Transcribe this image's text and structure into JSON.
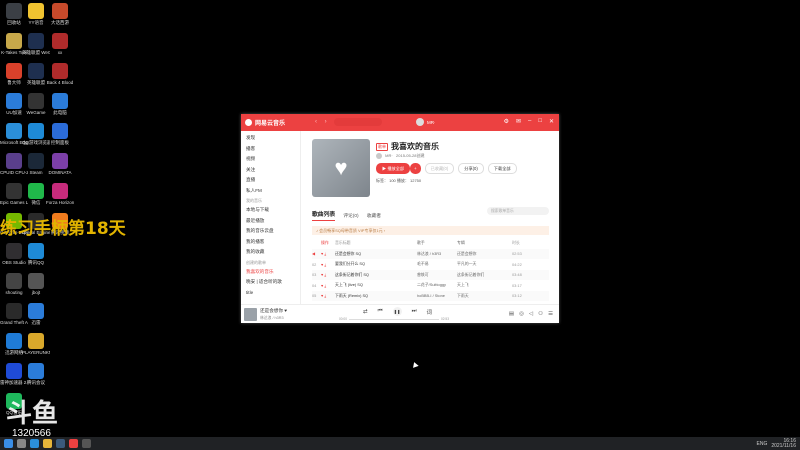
{
  "desktop": {
    "icons_col1": [
      {
        "label": "回收站",
        "icon": "recycle-bin",
        "color": "#3b3f45"
      },
      {
        "label": "K-Takes Tool",
        "icon": "ktakes",
        "color": "#c7a84a"
      },
      {
        "label": "鲁大师",
        "icon": "ludashi",
        "color": "#d9412b"
      },
      {
        "label": "UU加速",
        "icon": "uu-accelerator",
        "color": "#2b7cd9"
      },
      {
        "label": "Microsoft Edge",
        "icon": "edge",
        "color": "#2b8fd9"
      },
      {
        "label": "CPUID CPU-Z",
        "icon": "cpuz",
        "color": "#5a3f8c"
      },
      {
        "label": "Epic Games Launcher",
        "icon": "epic",
        "color": "#333333"
      },
      {
        "label": "GeForce Experience",
        "icon": "geforce",
        "color": "#76b900"
      },
      {
        "label": "OBS Studio",
        "icon": "obs",
        "color": "#302e31"
      },
      {
        "label": "shouting",
        "icon": "shouting",
        "color": "#444444"
      },
      {
        "label": "Grand Theft Auto V",
        "icon": "gta",
        "color": "#2a2a2a"
      },
      {
        "label": "迅游网络",
        "icon": "xunyou",
        "color": "#1f7bd6"
      },
      {
        "label": "雷神加速器 2.0",
        "icon": "leishen",
        "color": "#1f4bd6"
      },
      {
        "label": "QQ音乐",
        "icon": "qqmusic",
        "color": "#1eb85c"
      }
    ],
    "icons_col2": [
      {
        "label": "YY语音",
        "icon": "yy",
        "color": "#f0c330"
      },
      {
        "label": "英雄联盟 WeGame版",
        "icon": "lol",
        "color": "#1e2f4f"
      },
      {
        "label": "英雄联盟",
        "icon": "lol2",
        "color": "#1e2f4f"
      },
      {
        "label": "WeGame",
        "icon": "wegame",
        "color": "#333333"
      },
      {
        "label": "QQ游戏浏览器",
        "icon": "qqgame",
        "color": "#1e8ad6"
      },
      {
        "label": "Steam",
        "icon": "steam",
        "color": "#1b2838"
      },
      {
        "label": "微信",
        "icon": "wechat",
        "color": "#20b84a"
      },
      {
        "label": "Unreal Engine",
        "icon": "unreal",
        "color": "#2a2a2a"
      },
      {
        "label": "腾讯QQ",
        "icon": "qq",
        "color": "#1e8ad6"
      },
      {
        "label": "jbojt",
        "icon": "jbojt",
        "color": "#555555"
      },
      {
        "label": "迅雷",
        "icon": "xunlei",
        "color": "#2b7cd9"
      },
      {
        "label": "PLAYERUNKNOWN'S BATTLEGROUNDS",
        "icon": "pubg",
        "color": "#d9a82b"
      },
      {
        "label": "腾讯会议",
        "icon": "tencent-meeting",
        "color": "#2b7cd9"
      }
    ],
    "icons_col3": [
      {
        "label": "大话西游",
        "icon": "dahuaxiyou",
        "color": "#c74a2b"
      },
      {
        "label": "xx",
        "icon": "game-xx",
        "color": "#b02b2b"
      },
      {
        "label": "Back 4 Blood",
        "icon": "b4b",
        "color": "#b02b2b"
      },
      {
        "label": "此电脑",
        "icon": "this-pc",
        "color": "#2b7cd9"
      },
      {
        "label": "控制面板",
        "icon": "control-panel",
        "color": "#2b6cd9"
      },
      {
        "label": "DOMINATA",
        "icon": "dominata",
        "color": "#7c3fa8"
      },
      {
        "label": "Forza Horizon 5",
        "icon": "forza",
        "color": "#c72b7c"
      },
      {
        "label": "腾讯视频",
        "icon": "tencent-video",
        "color": "#f07c1e"
      }
    ],
    "overlay_title": "练习手柄第18天",
    "watermark_logo": "斗鱼",
    "watermark_number": "1320566"
  },
  "taskbar": {
    "pinned": [
      {
        "icon": "windows-start",
        "color": "#3a8ee6"
      },
      {
        "icon": "search",
        "color": "#888888"
      },
      {
        "icon": "edge",
        "color": "#2b8fd9"
      },
      {
        "icon": "file-explorer",
        "color": "#e6b53a"
      },
      {
        "icon": "steam",
        "color": "#3b5a7c"
      },
      {
        "icon": "netease-music",
        "color": "#ec4141"
      },
      {
        "icon": "obs",
        "color": "#555555"
      }
    ],
    "lang": "ENG",
    "time": "16:16",
    "date": "2021/11/16"
  },
  "app": {
    "title": "网易云音乐",
    "search_placeholder": "",
    "username": "MR·",
    "sidebar": {
      "items": [
        {
          "label": "发现",
          "active": false
        },
        {
          "label": "播客",
          "active": false
        },
        {
          "label": "视频",
          "active": false
        },
        {
          "label": "关注",
          "active": false
        },
        {
          "label": "直播",
          "active": false
        },
        {
          "label": "私人FM",
          "active": false
        }
      ],
      "section_my": "我的音乐",
      "my_items": [
        {
          "label": "本地与下载"
        },
        {
          "label": "最近播放"
        },
        {
          "label": "我的音乐云盘"
        },
        {
          "label": "我的播客"
        },
        {
          "label": "我的收藏"
        }
      ],
      "section_created": "创建的歌单",
      "created_items": [
        {
          "label": "我喜欢的音乐",
          "active": true
        },
        {
          "label": "晚安 | 适合听的歌"
        },
        {
          "label": "title"
        }
      ]
    },
    "playlist": {
      "badge": "歌单",
      "title": "我喜欢的音乐",
      "creator": "MR·",
      "created": "2015-05-28创建",
      "buttons": {
        "play_all": "▶ 播放全部",
        "add": "+",
        "collect": "已收藏(0)",
        "share": "分享(0)",
        "download": "下载全部"
      },
      "stats": "标签：  100    播放：  12750"
    },
    "tabs": [
      {
        "label": "歌曲列表",
        "active": true
      },
      {
        "label": "评论(0)",
        "active": false
      },
      {
        "label": "收藏者",
        "active": false
      }
    ],
    "search_in_playlist": "搜索歌单音乐",
    "vip_banner": "♪ 会员畅享SQ母带音质  VIP专享仅1元  ›",
    "table": {
      "headers": {
        "title": "音乐标题",
        "artist": "歌手",
        "album": "专辑",
        "duration": "时长"
      },
      "rows": [
        {
          "idx": "",
          "title": "还是会想你 SQ",
          "artist": "林达浪 / h3R3",
          "album": "还是会想你",
          "duration": "02:53",
          "playing": true
        },
        {
          "idx": "02",
          "title": "要我们分开么 SQ",
          "artist": "毛不易",
          "album": "平凡的一天",
          "duration": "04:22",
          "playing": false
        },
        {
          "idx": "03",
          "title": "这条街记着你们 SQ",
          "artist": "曾轶可",
          "album": "这条街记着你们",
          "duration": "03:48",
          "playing": false
        },
        {
          "idx": "04",
          "title": "天上飞 (live) SQ",
          "artist": "二花子/Suittoggy",
          "album": "天上飞",
          "duration": "03:17",
          "playing": false
        },
        {
          "idx": "05",
          "title": "下雨天 (Remix) SQ",
          "artist": "hoBBB-I / Stone",
          "album": "下雨天",
          "duration": "03:12",
          "playing": false
        }
      ]
    },
    "player": {
      "song": "还是会想你 ♥",
      "artist": "林达浪 / h3R3",
      "time_current": "00:00",
      "time_total": "02:53",
      "progress": 0.0
    }
  }
}
